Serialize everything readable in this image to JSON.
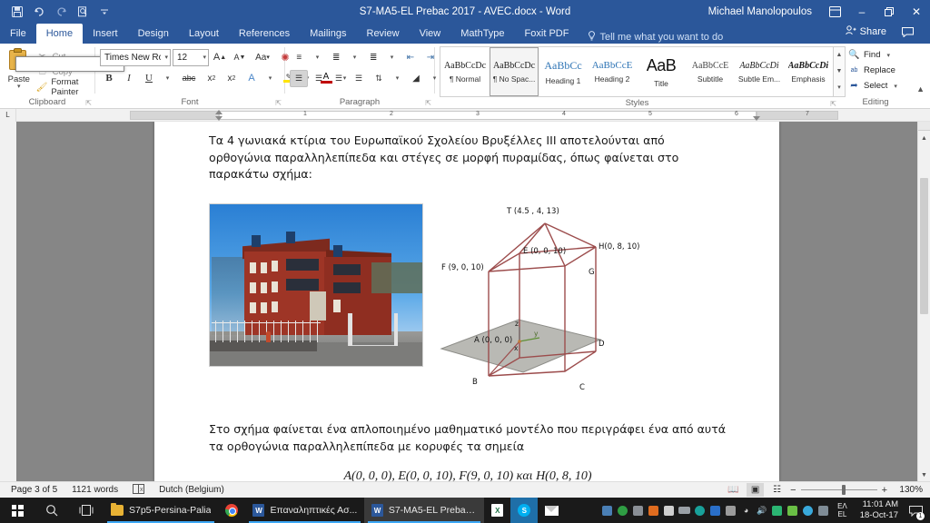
{
  "titlebar": {
    "title": "S7-MA5-EL Prebac 2017 - AVEC.docx  -  Word",
    "user": "Michael Manolopoulos",
    "qat": [
      {
        "name": "save-icon",
        "tip": "Save"
      },
      {
        "name": "undo-icon",
        "tip": "Undo"
      },
      {
        "name": "redo-icon",
        "tip": "Repeat"
      },
      {
        "name": "print-preview-icon",
        "tip": "Print Preview and Print"
      },
      {
        "name": "customize-quick-access-toolbar-icon",
        "tip": "Customize Quick Access Toolbar"
      }
    ],
    "ribbon_display_options": "ribbon-display-options-icon",
    "minimize": "–",
    "restore": "❐",
    "close": "✕"
  },
  "tabs": [
    {
      "label": "File",
      "active": false
    },
    {
      "label": "Home",
      "active": true
    },
    {
      "label": "Insert",
      "active": false
    },
    {
      "label": "Design",
      "active": false
    },
    {
      "label": "Layout",
      "active": false
    },
    {
      "label": "References",
      "active": false
    },
    {
      "label": "Mailings",
      "active": false
    },
    {
      "label": "Review",
      "active": false
    },
    {
      "label": "View",
      "active": false
    },
    {
      "label": "MathType",
      "active": false
    },
    {
      "label": "Foxit PDF",
      "active": false
    }
  ],
  "tellme": {
    "label": "Tell me what you want to do",
    "icon": "lightbulb-icon"
  },
  "share": {
    "label": "Share",
    "icon": "share-person-icon",
    "comments_icon": "comments-icon"
  },
  "ribbon": {
    "clipboard": {
      "group_label": "Clipboard",
      "paste": "Paste",
      "cut": "Cut",
      "copy": "Copy",
      "format_painter": "Format Painter"
    },
    "font": {
      "group_label": "Font",
      "font_name": "Times New Ro",
      "font_size": "12",
      "buttons": [
        {
          "name": "grow-font-icon",
          "label": "A"
        },
        {
          "name": "shrink-font-icon",
          "label": "A"
        },
        {
          "name": "change-case-icon",
          "label": "Aa"
        },
        {
          "name": "clear-formatting-icon",
          "label": "✐"
        },
        {
          "name": "bold-icon",
          "label": "B"
        },
        {
          "name": "italic-icon",
          "label": "I"
        },
        {
          "name": "underline-icon",
          "label": "U"
        },
        {
          "name": "strikethrough-icon",
          "label": "abc"
        },
        {
          "name": "subscript-icon",
          "label": "x"
        },
        {
          "name": "superscript-icon",
          "label": "x"
        },
        {
          "name": "text-effects-icon",
          "label": "A"
        },
        {
          "name": "text-highlight-color-icon",
          "label": "ab"
        },
        {
          "name": "font-color-icon",
          "label": "A"
        }
      ]
    },
    "paragraph": {
      "group_label": "Paragraph",
      "buttons": [
        {
          "name": "bullets-icon"
        },
        {
          "name": "numbering-icon"
        },
        {
          "name": "multilevel-list-icon"
        },
        {
          "name": "decrease-indent-icon"
        },
        {
          "name": "increase-indent-icon"
        },
        {
          "name": "sort-icon"
        },
        {
          "name": "show-formatting-marks-icon"
        },
        {
          "name": "align-left-icon"
        },
        {
          "name": "align-center-icon"
        },
        {
          "name": "align-right-icon"
        },
        {
          "name": "justify-icon"
        },
        {
          "name": "line-spacing-icon"
        },
        {
          "name": "shading-icon"
        },
        {
          "name": "borders-icon"
        }
      ]
    },
    "styles": {
      "group_label": "Styles",
      "items": [
        {
          "preview": "AaBbCcDc",
          "name": "¶ Normal",
          "selected": false,
          "kind": "normal"
        },
        {
          "preview": "AaBbCcDc",
          "name": "¶ No Spac...",
          "selected": true,
          "kind": "normal"
        },
        {
          "preview": "AaBbCс",
          "name": "Heading 1",
          "selected": false,
          "kind": "h1"
        },
        {
          "preview": "AaBbCcE",
          "name": "Heading 2",
          "selected": false,
          "kind": "h2"
        },
        {
          "preview": "AaB",
          "name": "Title",
          "selected": false,
          "kind": "title"
        },
        {
          "preview": "AaBbCcE",
          "name": "Subtitle",
          "selected": false,
          "kind": "sub"
        },
        {
          "preview": "AaBbCcDі",
          "name": "Subtle Em...",
          "selected": false,
          "kind": "italic"
        },
        {
          "preview": "AaBbCcDі",
          "name": "Emphasis",
          "selected": false,
          "kind": "bolditalic"
        }
      ]
    },
    "editing": {
      "group_label": "Editing",
      "find": "Find",
      "replace": "Replace",
      "select": "Select"
    }
  },
  "ruler": {
    "tab_stop_marker": "L",
    "numbers": [
      "1",
      "2",
      "3",
      "4",
      "5",
      "6",
      "7"
    ]
  },
  "document": {
    "paragraph_1": "Τα 4 γωνιακά κτίρια του Ευρωπαϊκού Σχολείου Βρυξέλλες III αποτελούνται από ορθογώνια παραλληλεπίπεδα και στέγες σε μορφή πυραμίδας, όπως φαίνεται στο παρακάτω σχήμα:",
    "paragraph_2": "Στο σχήμα φαίνεται ένα απλοποιημένο μαθηματικό μοντέλο που περιγράφει ένα από αυτά τα ορθογώνια παραλληλεπίπεδα με κορυφές τα σημεία",
    "paragraph_3": "A(0, 0, 0), E(0, 0, 10), F(9, 0, 10) και H(0, 8, 10)",
    "photo_alt": "Photograph of the red brick European School Brussels III building behind a fence",
    "diagram": {
      "labels": [
        {
          "text": "T (4.5 , 4, 13)",
          "name": "vertex-label-T"
        },
        {
          "text": "E (0, 0, 10)",
          "name": "vertex-label-E"
        },
        {
          "text": "H(0, 8, 10)",
          "name": "vertex-label-H"
        },
        {
          "text": "F (9, 0, 10)",
          "name": "vertex-label-F"
        },
        {
          "text": "G",
          "name": "vertex-label-G"
        },
        {
          "text": "A (0, 0, 0)",
          "name": "vertex-label-A"
        },
        {
          "text": "B",
          "name": "vertex-label-B"
        },
        {
          "text": "C",
          "name": "vertex-label-C"
        },
        {
          "text": "D",
          "name": "vertex-label-D"
        },
        {
          "text": "x",
          "name": "axis-label-x"
        },
        {
          "text": "y",
          "name": "axis-label-y"
        },
        {
          "text": "z",
          "name": "axis-label-z"
        }
      ]
    }
  },
  "statusbar": {
    "page": "Page 3 of 5",
    "words": "1121 words",
    "proofing_icon": "proofing-errors-icon",
    "language": "Dutch (Belgium)",
    "views": [
      {
        "name": "read-mode-icon",
        "selected": false
      },
      {
        "name": "print-layout-icon",
        "selected": true
      },
      {
        "name": "web-layout-icon",
        "selected": false
      }
    ],
    "zoom_out": "−",
    "zoom_in": "+",
    "zoom": "130%"
  },
  "taskbar": {
    "start_icon": "windows-start-icon",
    "search_icon": "search-icon",
    "taskview_icon": "task-view-icon",
    "apps": [
      {
        "label": "S7p5-Persina-Palia",
        "icon": "folder-icon",
        "active": false
      },
      {
        "label": "",
        "icon": "chrome-icon",
        "active": false
      },
      {
        "label": "Επαναληπτικές Ασ...",
        "icon": "word-icon",
        "active": false
      },
      {
        "label": "S7-MA5-EL Prebac ...",
        "icon": "word-icon",
        "active": true
      },
      {
        "label": "",
        "icon": "excel-icon",
        "active": false
      },
      {
        "label": "",
        "icon": "skype-icon",
        "active": false
      },
      {
        "label": "",
        "icon": "mail-icon",
        "active": false
      }
    ],
    "tray_icons": [
      "network-monitor-icon",
      "shield-check-icon",
      "display-icon",
      "antivirus-icon",
      "battery-small-icon",
      "usb-icon",
      "onedrive-icon",
      "dropbox-icon",
      "printer-icon",
      "wifi-icon",
      "volume-icon",
      "sync-icon",
      "evernote-icon",
      "skype-tray-icon",
      "network-icon"
    ],
    "language_top": "EΛ",
    "language_bottom": "EL",
    "time": "11:01 AM",
    "date": "18-Oct-17",
    "notification_icon": "action-center-icon",
    "notification_count": "1"
  },
  "colors": {
    "word_blue": "#2b579a",
    "diagram_line": "#9c4c4c",
    "workspace_gray": "#868686"
  }
}
